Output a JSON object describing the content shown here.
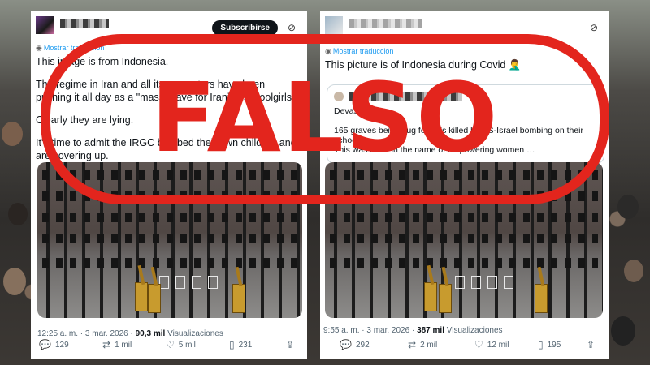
{
  "left_post": {
    "subscribe_label": "Subscribirse",
    "translate_label": "Mostrar traducción",
    "paragraphs": [
      "This image is from Indonesia.",
      "The regime in Iran and all its supporters have been pushing it all day as a \"mass grave for Iranian schoolgirls\".",
      "Clearly they are lying.",
      "It's time to admit the IRGC bombed their own children and are covering up."
    ],
    "time": "12:25 a. m. · 3 mar. 2026 ·",
    "views_count": "90,3 mil",
    "views_label": "Visualizaciones",
    "replies": "129",
    "reposts": "1 mil",
    "likes": "5 mil",
    "bookmarks": "231"
  },
  "right_post": {
    "translate_label": "Mostrar traducción",
    "text": "This picture is of Indonesia during Covid 🤦‍♂️",
    "quote_title": "Devastating",
    "quote_line1": "165 graves being dug for girls killed by US-Israel bombing on their school",
    "quote_line2": "This was done in the name of empowering women …",
    "time": "9:55 a. m. · 3 mar. 2026 ·",
    "views_count": "387 mil",
    "views_label": "Visualizaciones",
    "replies": "292",
    "reposts": "2 mil",
    "likes": "12 mil",
    "bookmarks": "195"
  },
  "stamp": {
    "text": "FALSO",
    "color": "#e3251d"
  },
  "icons": [
    "grok-icon",
    "reply-icon",
    "repost-icon",
    "like-icon",
    "views-icon",
    "share-icon"
  ]
}
